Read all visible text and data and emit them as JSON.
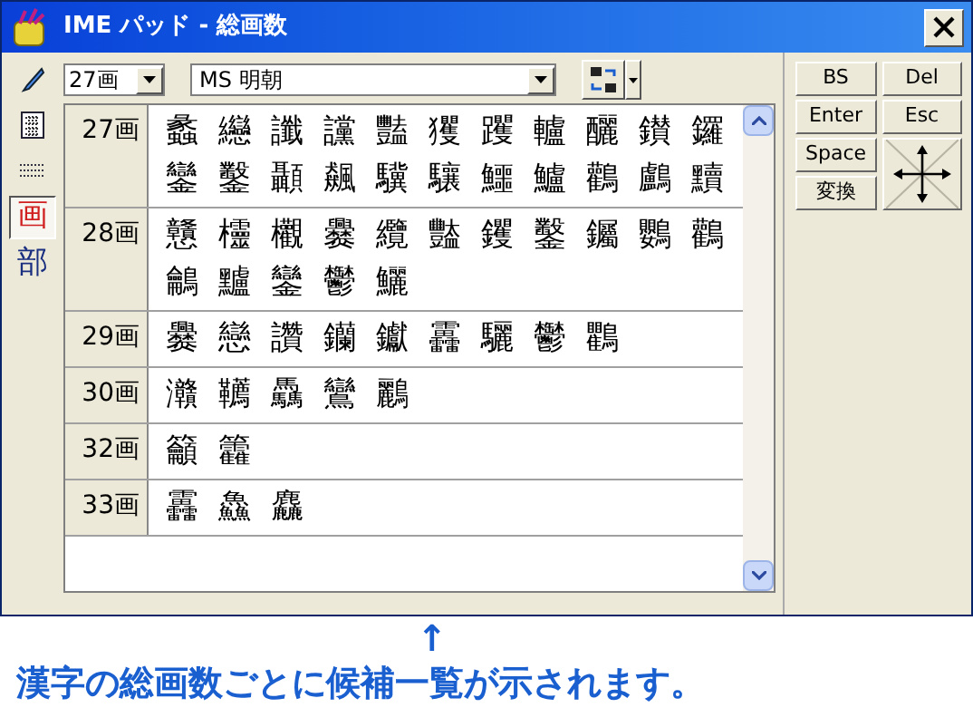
{
  "window": {
    "title": "IME パッド - 総画数"
  },
  "tools": [
    {
      "kind": "pen",
      "selected": false
    },
    {
      "kind": "grid",
      "selected": false
    },
    {
      "kind": "keyboard",
      "selected": false
    },
    {
      "kind": "glyph",
      "label": "画",
      "selected": true
    },
    {
      "kind": "glyph",
      "label": "部",
      "selected": false
    }
  ],
  "stroke_select": {
    "value": "27画"
  },
  "font_select": {
    "value": "MS 明朝"
  },
  "groups": [
    {
      "label": "27画",
      "chars": [
        "蠡",
        "纞",
        "讖",
        "讜",
        "豔",
        "玃",
        "躩",
        "轤",
        "釃",
        "鑚",
        "鑼",
        "鑾",
        "鑿",
        "顳",
        "飆",
        "驥",
        "驤",
        "鱷",
        "鱸",
        "鸛",
        "鸕",
        "黷"
      ]
    },
    {
      "label": "28画",
      "chars": [
        "戇",
        "欞",
        "欟",
        "爨",
        "纜",
        "豓",
        "钁",
        "鑿",
        "钃",
        "鸚",
        "鸛",
        "鸙",
        "黸",
        "鑾",
        "鬱",
        "鱺"
      ]
    },
    {
      "label": "29画",
      "chars": [
        "爨",
        "戀",
        "讚",
        "钄",
        "钀",
        "靐",
        "驪",
        "鬱",
        "鸜"
      ]
    },
    {
      "label": "30画",
      "chars": [
        "灨",
        "韉",
        "驫",
        "鸞",
        "鸝"
      ]
    },
    {
      "label": "32画",
      "chars": [
        "籲",
        "籱"
      ]
    },
    {
      "label": "33画",
      "chars": [
        "靐",
        "鱻",
        "麤"
      ]
    }
  ],
  "keys": [
    {
      "label": "BS"
    },
    {
      "label": "Del"
    },
    {
      "label": "Enter"
    },
    {
      "label": "Esc"
    },
    {
      "label": "Space"
    },
    {
      "label": "変換"
    }
  ],
  "caption": {
    "arrow": "↑",
    "text": "漢字の総画数ごとに候補一覧が示されます。"
  }
}
